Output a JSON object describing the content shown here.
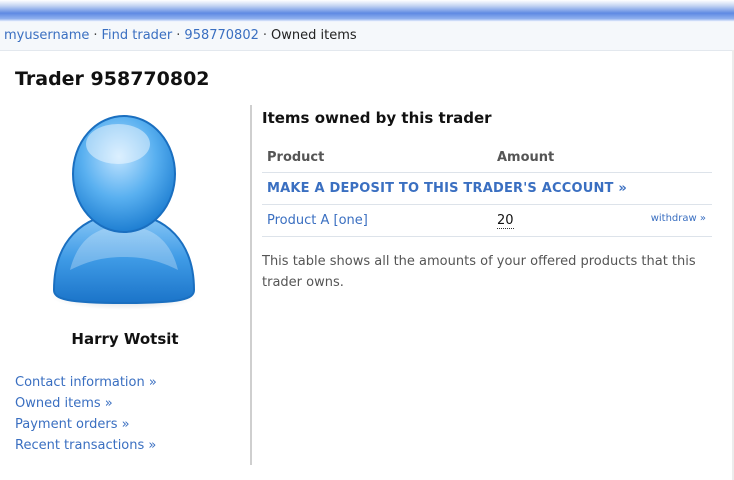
{
  "breadcrumb": {
    "items": [
      "myusername",
      "Find trader",
      "958770802"
    ],
    "current": "Owned items",
    "separator": "·"
  },
  "page": {
    "title": "Trader 958770802"
  },
  "sidebar": {
    "avatar_icon": "user-silhouette-icon",
    "name": "Harry Wotsit",
    "links": [
      "Contact information »",
      "Owned items »",
      "Payment orders »",
      "Recent transactions »"
    ]
  },
  "main": {
    "heading": "Items owned by this trader",
    "table": {
      "columns": [
        "Product",
        "Amount"
      ],
      "deposit_link": "MAKE A DEPOSIT TO THIS TRADER'S ACCOUNT »",
      "rows": [
        {
          "product": "Product A [one]",
          "amount": "20",
          "action": "withdraw »"
        }
      ]
    },
    "note": "This table shows all the amounts of your offered products that this trader owns."
  },
  "colors": {
    "link": "#3a6fc1",
    "top_bar": "#5f8ae3",
    "avatar": "#4aa3ea"
  }
}
